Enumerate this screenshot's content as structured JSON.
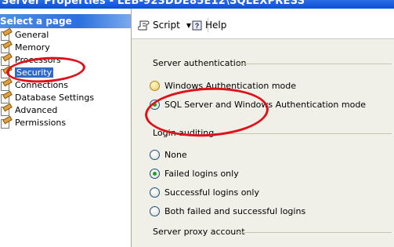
{
  "window": {
    "title": "Server Properties - LEB-923DDE85E12\\SQLEXPRESS"
  },
  "sidebar": {
    "header": "Select a page",
    "items": [
      {
        "label": "General",
        "icon": "page-properties-icon"
      },
      {
        "label": "Memory",
        "icon": "page-properties-icon"
      },
      {
        "label": "Processors",
        "icon": "page-properties-icon"
      },
      {
        "label": "Security",
        "icon": "page-properties-icon",
        "selected": true
      },
      {
        "label": "Connections",
        "icon": "page-properties-icon"
      },
      {
        "label": "Database Settings",
        "icon": "page-properties-icon"
      },
      {
        "label": "Advanced",
        "icon": "page-properties-icon"
      },
      {
        "label": "Permissions",
        "icon": "page-properties-icon"
      }
    ]
  },
  "toolbar": {
    "script_label": "Script",
    "help_label": "Help"
  },
  "content": {
    "server_auth": {
      "title": "Server authentication",
      "options": [
        {
          "label": "Windows Authentication mode",
          "checked": false
        },
        {
          "label": "SQL Server and Windows Authentication mode",
          "checked": true
        }
      ]
    },
    "login_auditing": {
      "title": "Login auditing",
      "options": [
        {
          "label": "None",
          "checked": false
        },
        {
          "label": "Failed logins only",
          "checked": true
        },
        {
          "label": "Successful logins only",
          "checked": false
        },
        {
          "label": "Both failed and successful logins",
          "checked": false
        }
      ]
    },
    "proxy": {
      "title": "Server proxy account"
    }
  },
  "annotations": {
    "color": "#e0101a"
  }
}
